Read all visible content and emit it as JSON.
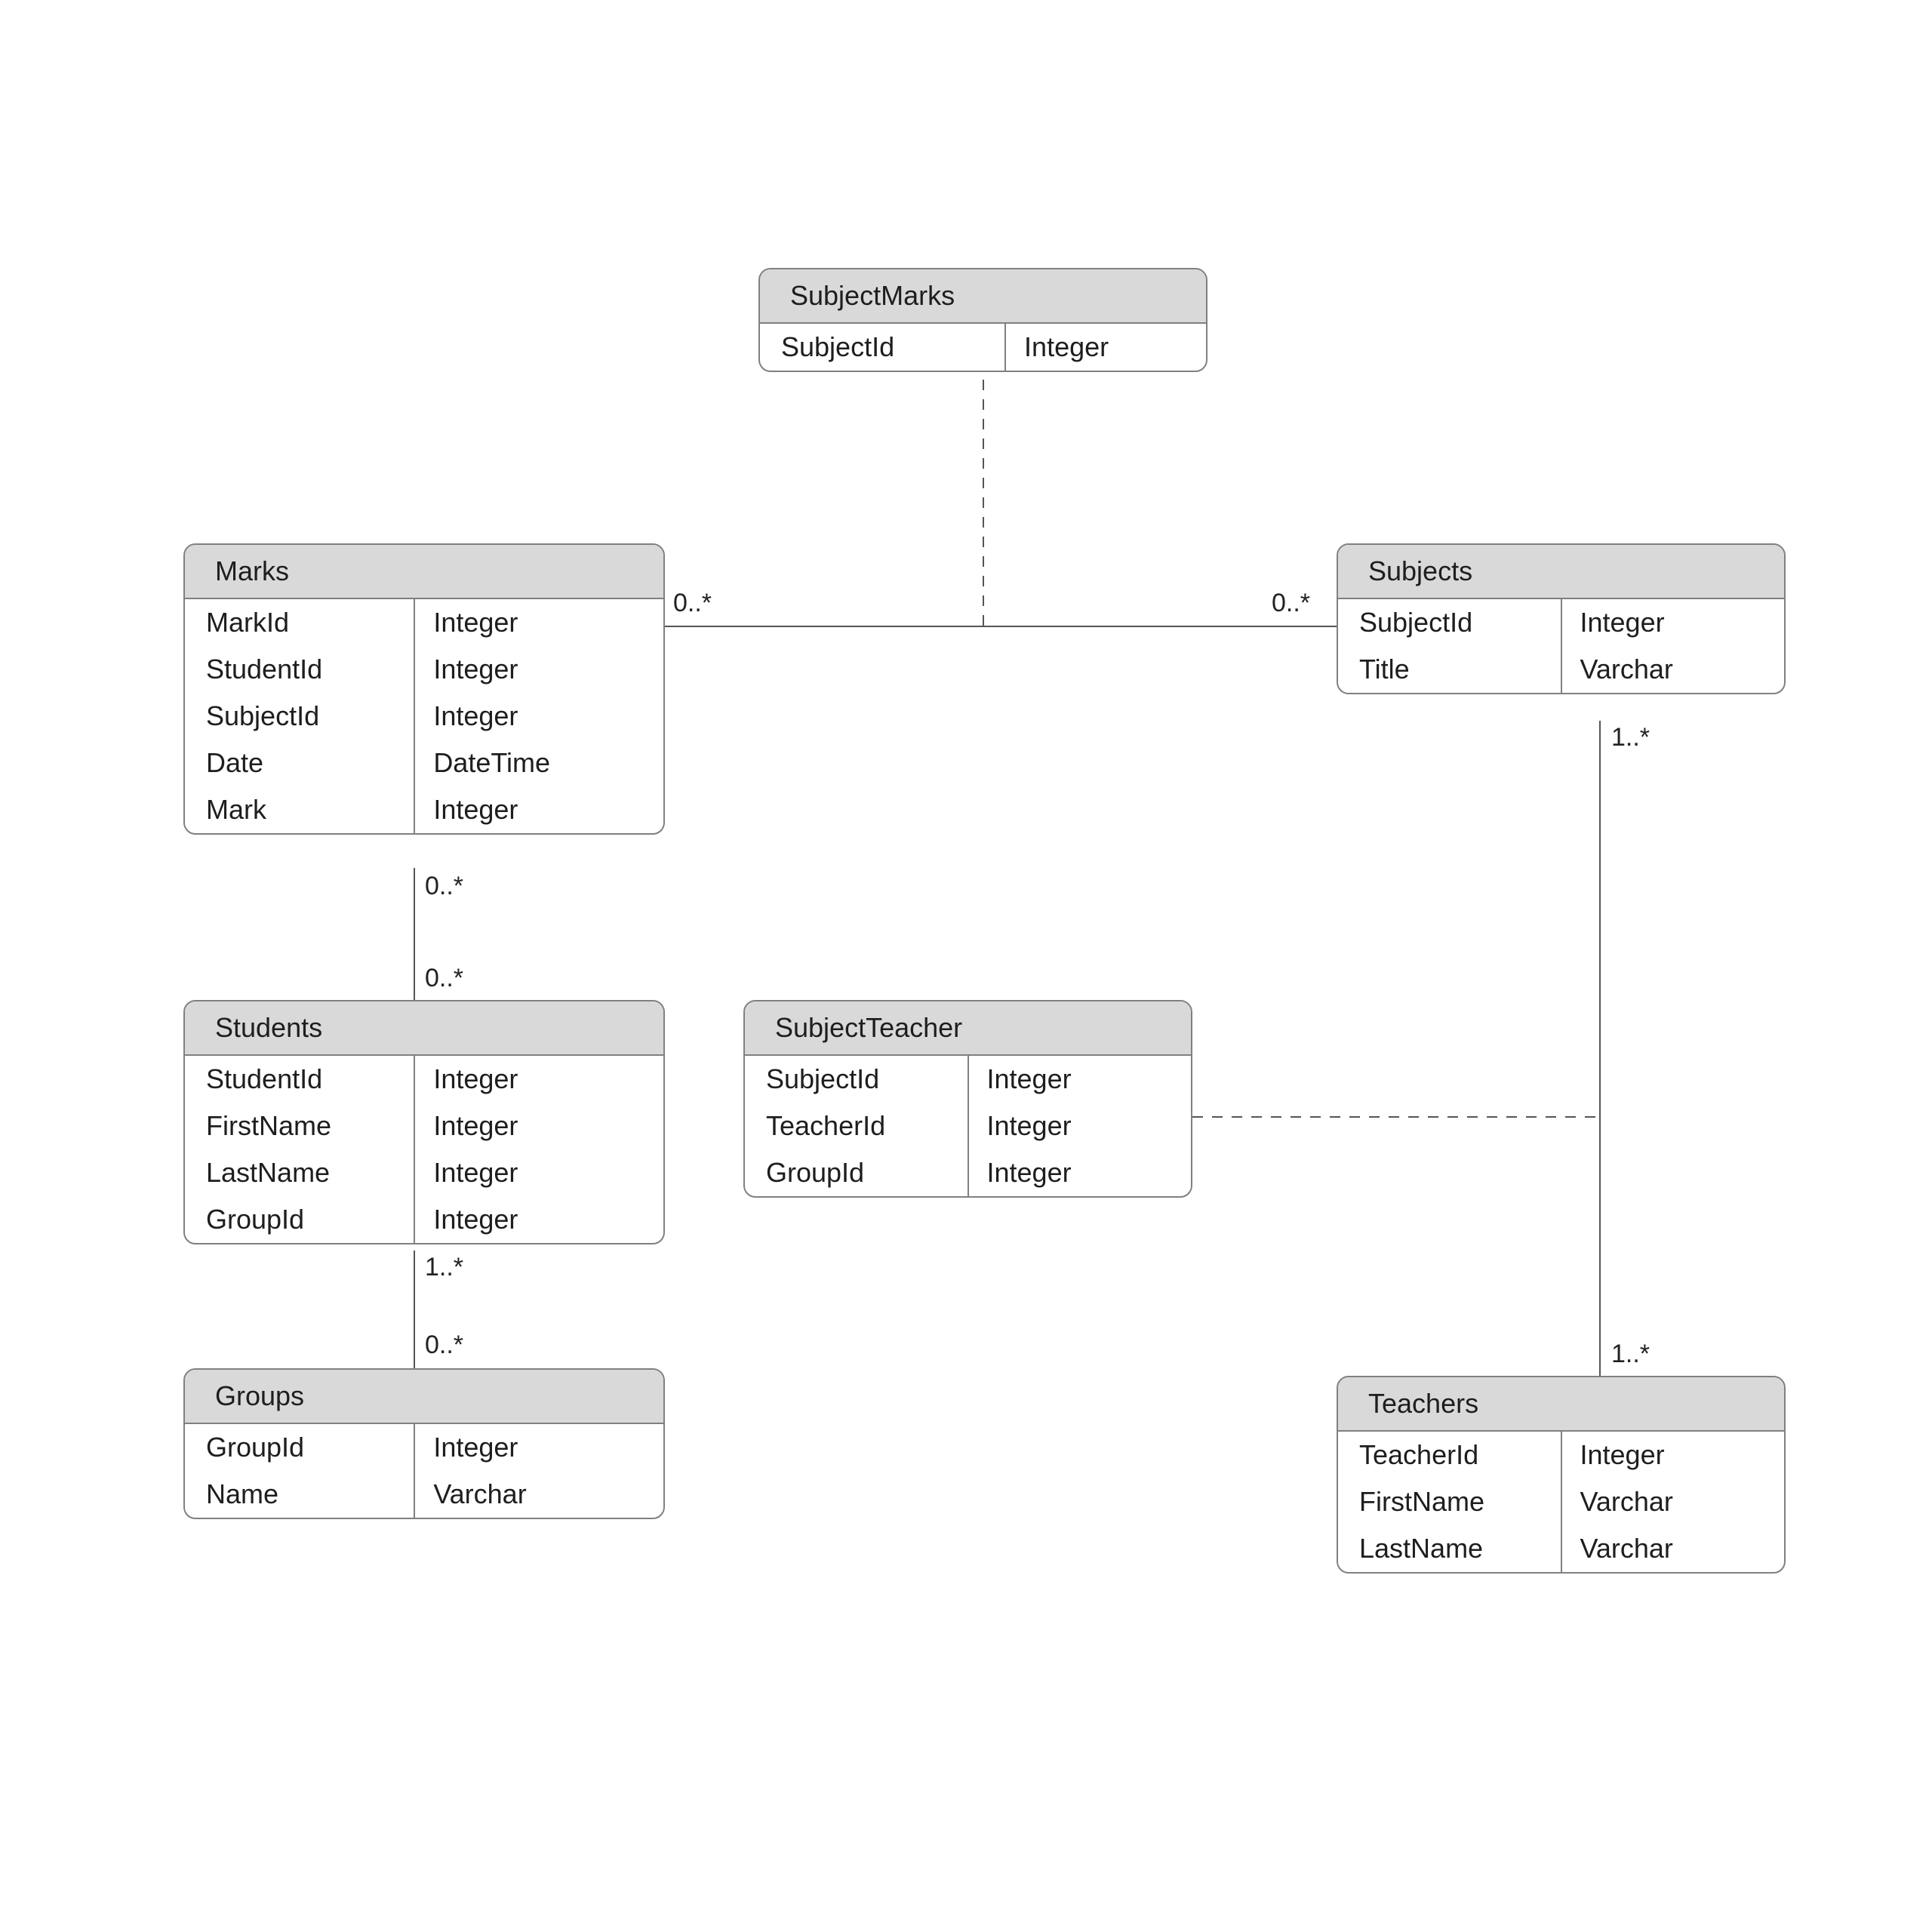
{
  "entities": {
    "subjectmarks": {
      "title": "SubjectMarks",
      "fields": [
        {
          "name": "SubjectId",
          "type": "Integer"
        }
      ]
    },
    "marks": {
      "title": "Marks",
      "fields": [
        {
          "name": "MarkId",
          "type": "Integer"
        },
        {
          "name": "StudentId",
          "type": "Integer"
        },
        {
          "name": "SubjectId",
          "type": "Integer"
        },
        {
          "name": "Date",
          "type": "DateTime"
        },
        {
          "name": "Mark",
          "type": "Integer"
        }
      ]
    },
    "subjects": {
      "title": "Subjects",
      "fields": [
        {
          "name": "SubjectId",
          "type": "Integer"
        },
        {
          "name": "Title",
          "type": "Varchar"
        }
      ]
    },
    "students": {
      "title": "Students",
      "fields": [
        {
          "name": "StudentId",
          "type": "Integer"
        },
        {
          "name": "FirstName",
          "type": "Integer"
        },
        {
          "name": "LastName",
          "type": "Integer"
        },
        {
          "name": "GroupId",
          "type": "Integer"
        }
      ]
    },
    "subjectteacher": {
      "title": "SubjectTeacher",
      "fields": [
        {
          "name": "SubjectId",
          "type": "Integer"
        },
        {
          "name": "TeacherId",
          "type": "Integer"
        },
        {
          "name": "GroupId",
          "type": "Integer"
        }
      ]
    },
    "groups": {
      "title": "Groups",
      "fields": [
        {
          "name": "GroupId",
          "type": "Integer"
        },
        {
          "name": "Name",
          "type": "Varchar"
        }
      ]
    },
    "teachers": {
      "title": "Teachers",
      "fields": [
        {
          "name": "TeacherId",
          "type": "Integer"
        },
        {
          "name": "FirstName",
          "type": "Varchar"
        },
        {
          "name": "LastName",
          "type": "Varchar"
        }
      ]
    }
  },
  "cardinalities": {
    "marks_subjects_left": "0..*",
    "marks_subjects_right": "0..*",
    "marks_students_top": "0..*",
    "marks_students_bot": "0..*",
    "students_groups_top": "1..*",
    "students_groups_bot": "0..*",
    "subjects_teachers_top": "1..*",
    "subjects_teachers_bot": "1..*"
  }
}
